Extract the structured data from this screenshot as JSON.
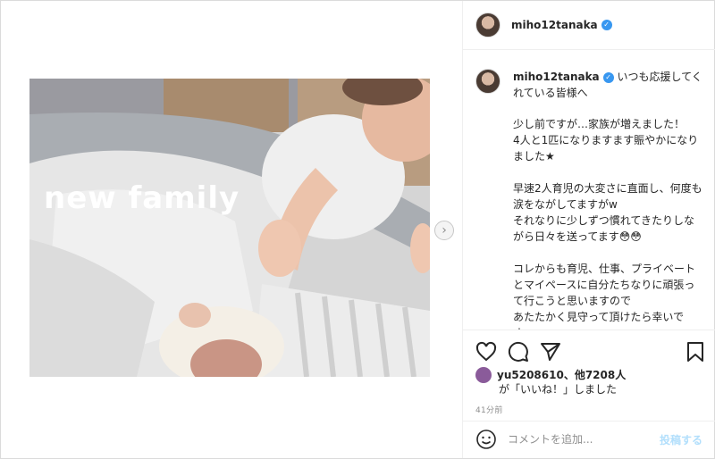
{
  "post": {
    "username": "miho12tanaka",
    "verified_icon": "verified-badge-icon",
    "image_text": "new family",
    "caption_lead": "いつも応援してくれている皆様へ",
    "caption_body": "少し前ですが…家族が増えました！\n4人と1匹になりますます賑やかになりました★\n\n早速2人育児の大変さに直面し、何度も涙をながしてますがw\nそれなりに少しずつ慣れてきたりしながら日々を送ってます😳😳\n\nコレからも育児、仕事、プライベートとマイペースに自分たちなりに頑張って行こうと思いますので\nあたたかく見守って頂けたら幸いです。。。\n\nこのコロナ禍に無事出産させてくれた"
  },
  "actions": {
    "like_icon": "heart-icon",
    "comment_icon": "comment-icon",
    "share_icon": "paper-plane-icon",
    "save_icon": "bookmark-icon"
  },
  "likes": {
    "text": "yu5208610、他7208人",
    "suffix": "が「いいね！」しました"
  },
  "timestamp": "41分前",
  "comment_box": {
    "placeholder": "コメントを追加...",
    "post_label": "投稿する",
    "emoji_icon": "smiley-icon"
  },
  "colors": {
    "verified": "#3897f0",
    "post_button": "#b2dffc",
    "border": "#efefef"
  }
}
